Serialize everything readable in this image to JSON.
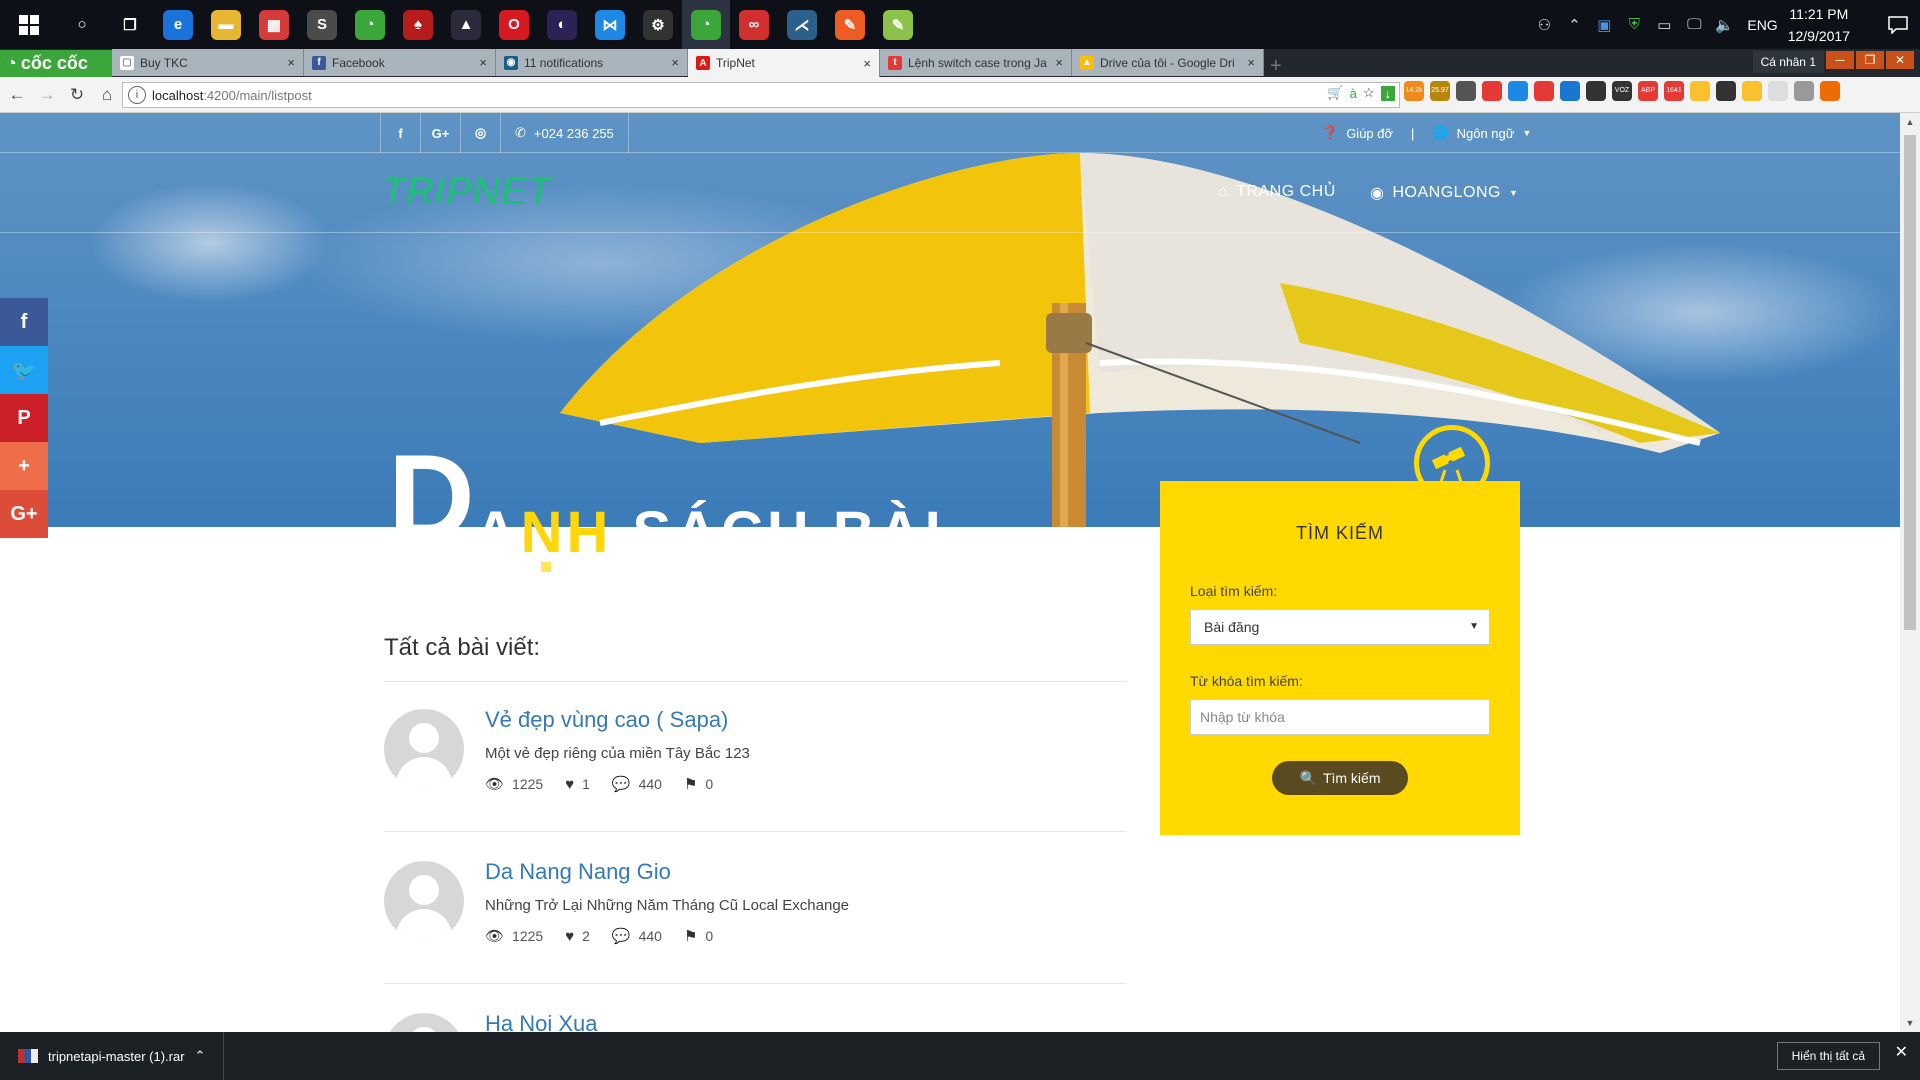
{
  "taskbar": {
    "apps": [
      {
        "icon": "cortana-icon",
        "color": "#0d1117",
        "glyph": "○"
      },
      {
        "icon": "task-view-icon",
        "color": "#0d1117",
        "glyph": "❐"
      },
      {
        "icon": "edge-icon",
        "color": "#1a73d9",
        "glyph": "e"
      },
      {
        "icon": "file-explorer-icon",
        "color": "#e7b632",
        "glyph": "▬"
      },
      {
        "icon": "store-icon",
        "color": "#d63b3b",
        "glyph": "▦"
      },
      {
        "icon": "sublime-icon",
        "color": "#4b4b4b",
        "glyph": "S"
      },
      {
        "icon": "coccoc-icon",
        "color": "#3ba73b",
        "glyph": "◔"
      },
      {
        "icon": "app-red-icon",
        "color": "#b71c1c",
        "glyph": "♠"
      },
      {
        "icon": "app-vlc-icon",
        "color": "#2a2a3a",
        "glyph": "▲"
      },
      {
        "icon": "opera-icon",
        "color": "#d71921",
        "glyph": "O"
      },
      {
        "icon": "eclipse-icon",
        "color": "#2c2255",
        "glyph": "◐"
      },
      {
        "icon": "vscode-icon",
        "color": "#1e88e5",
        "glyph": "⋈"
      },
      {
        "icon": "settings-app-icon",
        "color": "#333333",
        "glyph": "⚙"
      },
      {
        "icon": "coccoc-active-icon",
        "color": "#3ba73b",
        "glyph": "◔"
      },
      {
        "icon": "acrobat-icon",
        "color": "#d32f2f",
        "glyph": "∞"
      },
      {
        "icon": "mysql-workbench-icon",
        "color": "#2c5f8a",
        "glyph": "⋌"
      },
      {
        "icon": "postman-icon",
        "color": "#ef5b25",
        "glyph": "✎"
      },
      {
        "icon": "notepad-icon",
        "color": "#8bc34a",
        "glyph": "✎"
      }
    ],
    "lang": "ENG",
    "time": "11:21 PM",
    "date": "12/9/2017"
  },
  "browser": {
    "logo": "cốc cốc",
    "tabs": [
      {
        "title": "Buy TKC",
        "fav": "#ffffff",
        "fav_glyph": "▢",
        "active": false
      },
      {
        "title": "Facebook",
        "fav": "#3b5998",
        "fav_glyph": "f",
        "active": false
      },
      {
        "title": "11 notifications",
        "fav": "#1b5e8c",
        "fav_glyph": "◉",
        "active": false
      },
      {
        "title": "TripNet",
        "fav": "#dd1b16",
        "fav_glyph": "A",
        "active": true
      },
      {
        "title": "Lệnh switch case trong Ja",
        "fav": "#e53935",
        "fav_glyph": "t",
        "active": false
      },
      {
        "title": "Drive của tôi - Google Dri",
        "fav": "#fbbc05",
        "fav_glyph": "▲",
        "active": false
      }
    ],
    "profile": "Cá nhân 1",
    "url_host": "localhost",
    "url_path": ":4200/main/listpost",
    "ext_badges": [
      "14.2k",
      "25.97",
      "",
      "",
      "",
      "",
      "",
      "",
      "VOZ",
      "ABP",
      "1641",
      "",
      "",
      "",
      "",
      "",
      ""
    ]
  },
  "site": {
    "phone": "+024 236 255",
    "help": "Giúp đỡ",
    "separator": "|",
    "language": "Ngôn ngữ",
    "brand": "TRIPNET",
    "nav_home": "TRANG CHỦ",
    "nav_user": "HOANGLONG",
    "hero_first_letter": "D",
    "hero_rest_pre": "ANH ",
    "hero_rest_hl": "NH",
    "hero_rest_post": " SÁCH BÀI",
    "hero_split_a": "A",
    "hero_split_space": " ",
    "search": {
      "title": "TÌM KIẾM",
      "type_label": "Loại tìm kiếm:",
      "type_value": "Bài đăng",
      "keyword_label": "Từ khóa tìm kiếm:",
      "keyword_placeholder": "Nhập từ khóa",
      "button": "Tìm kiếm"
    },
    "posts_heading": "Tất cả bài viết:",
    "posts": [
      {
        "title": "Vẻ đẹp vùng cao ( Sapa)",
        "desc": "Một vẻ đẹp riêng của miền Tây Bắc 123",
        "views": "1225",
        "likes": "1",
        "comments": "440",
        "flags": "0"
      },
      {
        "title": "Da Nang Nang Gio",
        "desc": "Những Trở Lại Những Năm Tháng Cũ Local Exchange",
        "views": "1225",
        "likes": "2",
        "comments": "440",
        "flags": "0"
      },
      {
        "title": "Ha Noi Xua",
        "desc": "",
        "views": "",
        "likes": "",
        "comments": "",
        "flags": ""
      }
    ],
    "share": [
      {
        "icon": "facebook-share-icon",
        "color": "#3b5998",
        "glyph": "f"
      },
      {
        "icon": "twitter-share-icon",
        "color": "#1da1f2",
        "glyph": "🐦"
      },
      {
        "icon": "pinterest-share-icon",
        "color": "#cb2027",
        "glyph": "P"
      },
      {
        "icon": "more-share-icon",
        "color": "#ee6e4a",
        "glyph": "+"
      },
      {
        "icon": "googleplus-share-icon",
        "color": "#dd4b39",
        "glyph": "G+"
      }
    ]
  },
  "downloads": {
    "file": "tripnetapi-master (1).rar",
    "show_all": "Hiển thị tất cả"
  }
}
